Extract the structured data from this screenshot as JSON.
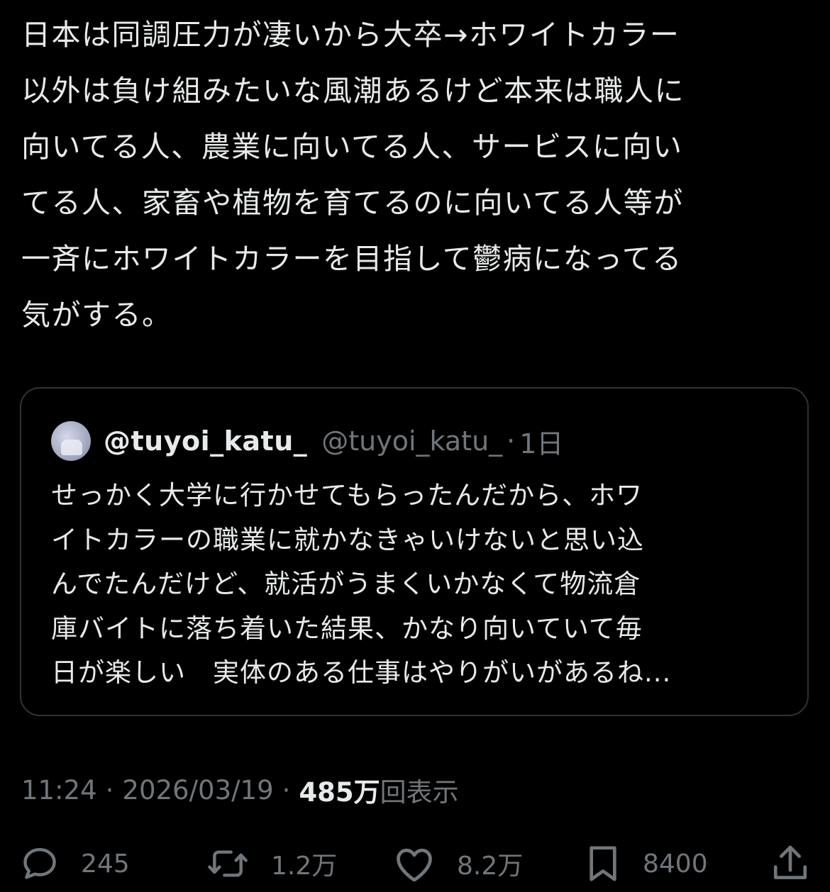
{
  "tweet": {
    "lines": [
      "日本は同調圧力が凄いから大卒→ホワイトカラー",
      "以外は負け組みたいな風潮あるけど本来は職人に",
      "向いてる人、農業に向いてる人、サービスに向い",
      "てる人、家畜や植物を育てるのに向いてる人等が",
      "一斉にホワイトカラーを目指して鬱病になってる",
      "気がする。"
    ]
  },
  "quote": {
    "display_name": "@tuyoi_katu_",
    "handle": "@tuyoi_katu_",
    "separator": "·",
    "time": "1日",
    "lines": [
      "せっかく大学に行かせてもらったんだから、ホワ",
      "イトカラーの職業に就かなきゃいけないと思い込",
      "んでたんだけど、就活がうまくいかなくて物流倉",
      "庫バイトに落ち着いた結果、かなり向いていて毎",
      "日が楽しい　実体のある仕事はやりがいがあるね..."
    ]
  },
  "meta": {
    "time": "11:24",
    "separator": "·",
    "date": "2026/03/19",
    "views_count": "485万",
    "views_label": "回表示"
  },
  "actions": {
    "reply": {
      "icon": "reply-icon",
      "count": "245"
    },
    "retweet": {
      "icon": "retweet-icon",
      "count": "1.2万"
    },
    "like": {
      "icon": "heart-icon",
      "count": "8.2万"
    },
    "bookmark": {
      "icon": "bookmark-icon",
      "count": "8400"
    },
    "share": {
      "icon": "share-icon"
    }
  },
  "colors": {
    "background": "#000000",
    "text": "#e7e9ea",
    "secondary": "#71767b",
    "border": "#2f3336"
  }
}
